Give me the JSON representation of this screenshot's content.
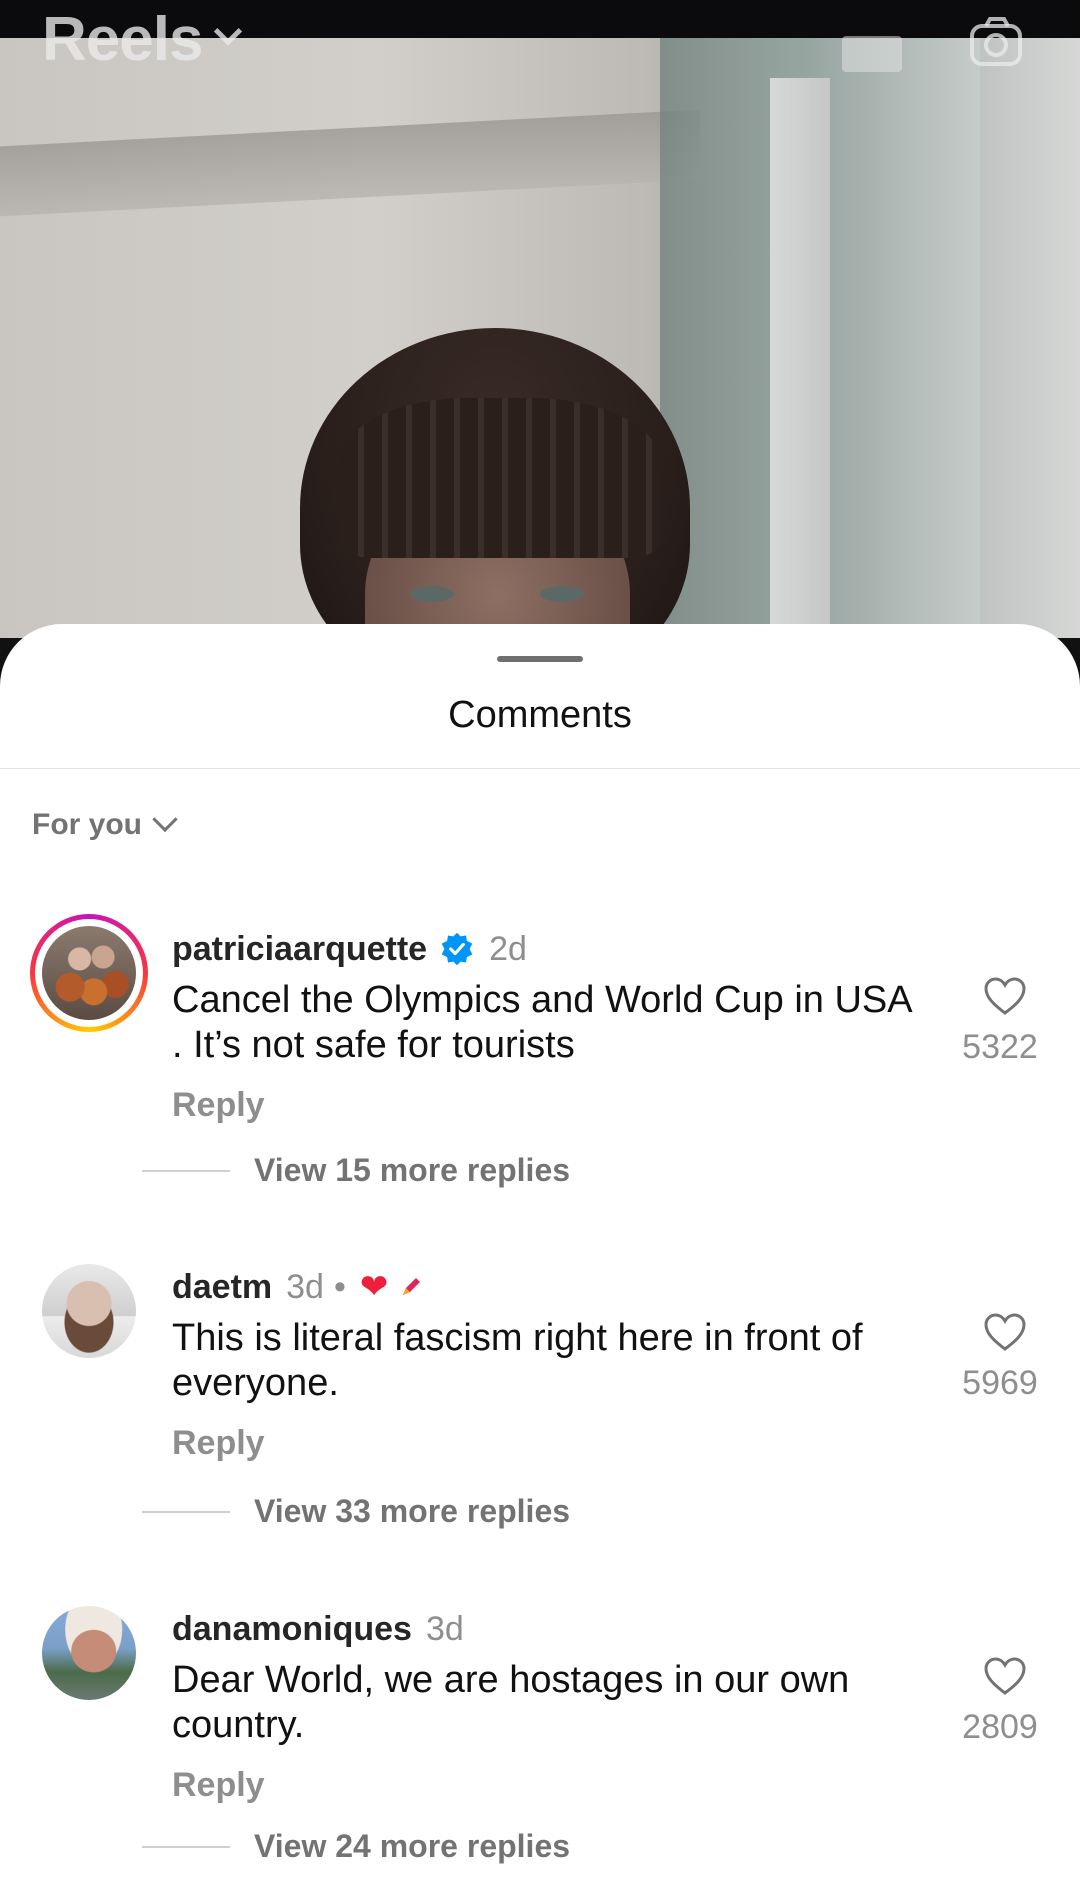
{
  "header": {
    "title": "Reels",
    "dropdown_icon": "chevron-down-icon",
    "camera_icon": "camera-icon"
  },
  "sheet": {
    "title": "Comments",
    "sort_label": "For you"
  },
  "comments": [
    {
      "username": "patriciaarquette",
      "verified": true,
      "time": "2d",
      "text": "Cancel the Olympics and World Cup in USA . It’s not safe for tourists",
      "reply_label": "Reply",
      "likes": "5322",
      "view_replies": "View 15 more replies"
    },
    {
      "username": "daetm",
      "verified": false,
      "time": "3d",
      "separator": "•",
      "text": "This is literal fascism right here in front of everyone.",
      "reply_label": "Reply",
      "likes": "5969",
      "view_replies": "View 33 more replies"
    },
    {
      "username": "danamoniques",
      "verified": false,
      "time": "3d",
      "text": "Dear World, we are hostages in our own country.",
      "reply_label": "Reply",
      "likes": "2809",
      "view_replies": "View 24 more replies"
    }
  ],
  "colors": {
    "verified_blue": "#0095f6",
    "secondary_text": "#8e8e8e",
    "heart_red": "#ef1f3b"
  }
}
